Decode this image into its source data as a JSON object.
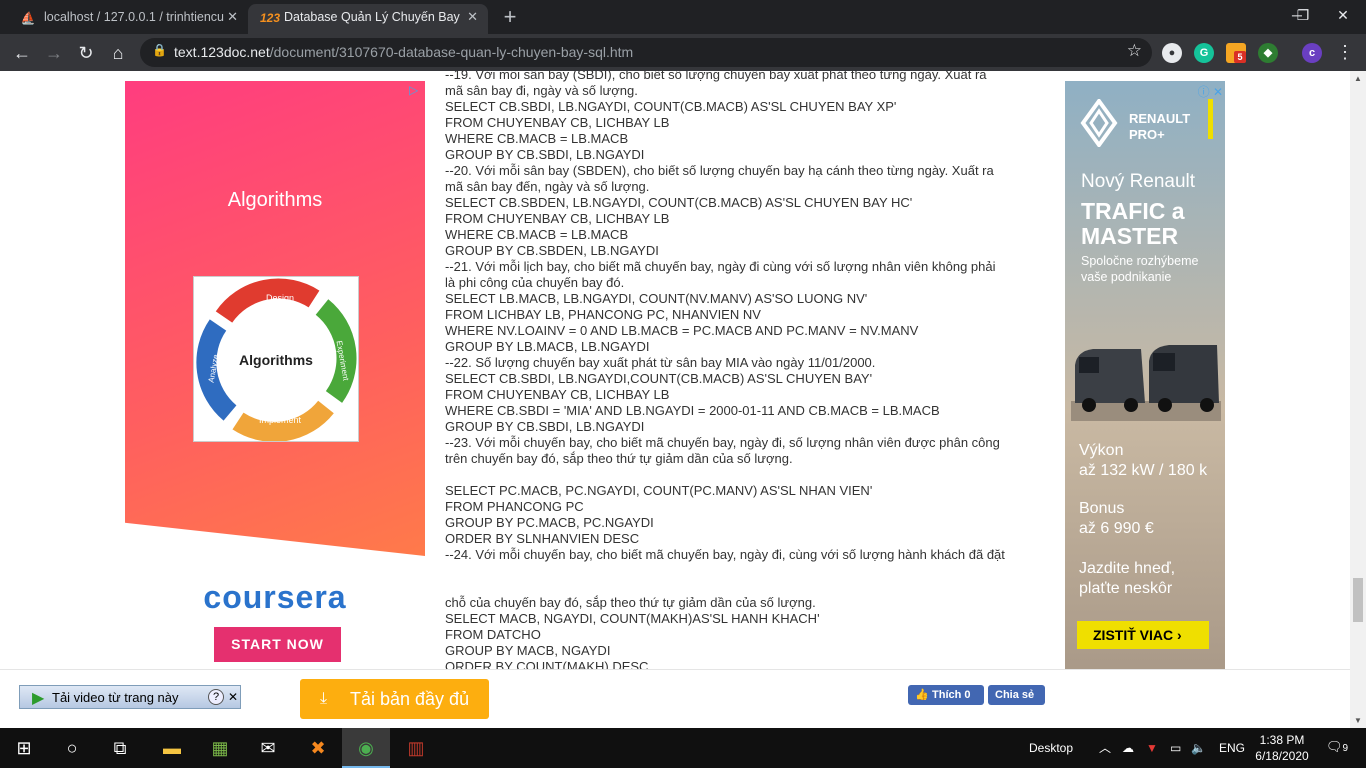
{
  "browser": {
    "tabs": [
      {
        "title": "localhost / 127.0.0.1 / trinhtiencu",
        "favicon": "phpmyadmin-icon",
        "active": false
      },
      {
        "title": "Database Quản Lý Chuyến Bay (S",
        "favicon": "123doc-icon",
        "active": true
      }
    ],
    "new_tab": "+",
    "url_host": "text.123doc.net",
    "url_path": "/document/3107670-database-quan-ly-chuyen-bay-sql.htm",
    "extension_badge": "5",
    "profile_initial": "c"
  },
  "left_ad": {
    "headline": "Algorithms",
    "diagram_center": "Algorithms",
    "diagram_labels": {
      "top": "Design",
      "right": "Experiment",
      "bottom": "Implement",
      "left": "Analyze"
    },
    "brand": "coursera",
    "cta": "START NOW"
  },
  "document": {
    "lines": [
      "--19. Với mỗi sân bay (SBDI), cho biết số lượng chuyến bay xuất phát theo từng ngày. Xuất ra",
      "mã sân bay đi, ngày và số lượng.",
      "SELECT CB.SBDI, LB.NGAYDI, COUNT(CB.MACB) AS'SL CHUYEN BAY XP'",
      "FROM CHUYENBAY CB, LICHBAY LB",
      "WHERE CB.MACB = LB.MACB",
      "GROUP BY CB.SBDI, LB.NGAYDI",
      "--20. Với mỗi sân bay (SBDEN), cho biết số lượng chuyến bay hạ cánh theo từng ngày. Xuất ra",
      "mã sân bay đến, ngày và số lượng.",
      "SELECT CB.SBDEN, LB.NGAYDI, COUNT(CB.MACB) AS'SL CHUYEN BAY HC'",
      "FROM CHUYENBAY CB, LICHBAY LB",
      "WHERE CB.MACB = LB.MACB",
      "GROUP BY CB.SBDEN, LB.NGAYDI",
      "--21. Với mỗi lịch bay, cho biết mã chuyến bay, ngày đi cùng với số lượng nhân viên không phải",
      "là phi công của chuyến bay đó.",
      "SELECT LB.MACB, LB.NGAYDI, COUNT(NV.MANV) AS'SO LUONG NV'",
      "FROM LICHBAY LB, PHANCONG PC, NHANVIEN NV",
      "WHERE NV.LOAINV = 0 AND LB.MACB = PC.MACB AND PC.MANV = NV.MANV",
      "GROUP BY LB.MACB, LB.NGAYDI",
      "--22. Số lượng chuyến bay xuất phát từ sân bay MIA vào ngày 11/01/2000.",
      "SELECT CB.SBDI, LB.NGAYDI,COUNT(CB.MACB) AS'SL CHUYEN BAY'",
      "FROM CHUYENBAY CB, LICHBAY LB",
      "WHERE CB.SBDI = 'MIA' AND LB.NGAYDI = 2000-01-11 AND CB.MACB = LB.MACB",
      "GROUP BY CB.SBDI, LB.NGAYDI",
      "--23. Với mỗi chuyến bay, cho biết mã chuyến bay, ngày đi, số lượng nhân viên được phân công",
      "trên chuyến bay đó, sắp theo thứ tự giảm dần của số lượng.",
      "",
      "SELECT PC.MACB, PC.NGAYDI, COUNT(PC.MANV) AS'SL NHAN VIEN'",
      "FROM PHANCONG PC",
      "GROUP BY PC.MACB, PC.NGAYDI",
      "ORDER BY SLNHANVIEN DESC",
      "--24. Với mỗi chuyến bay, cho biết mã chuyến bay, ngày đi, cùng với số lượng hành khách đã đặt",
      "",
      "",
      "chỗ của chuyến bay đó, sắp theo thứ tự giảm dần của số lượng.",
      "SELECT MACB, NGAYDI, COUNT(MAKH)AS'SL HANH KHACH'",
      "FROM DATCHO",
      "GROUP BY MACB, NGAYDI",
      "ORDER BY COUNT(MAKH) DESC"
    ]
  },
  "right_ad": {
    "brand": "RENAULT PRO+",
    "line1": "Nový Renault",
    "line2": "TRAFIC a MASTER",
    "line3": "Spoločne rozhýbeme vaše podnikanie",
    "power_label": "Výkon",
    "power_value": "až 132 kW / 180 k",
    "bonus_label": "Bonus",
    "bonus_value": "až 6 990 €",
    "slogan": "Jazdite hneď, plaťte neskôr",
    "cta": "ZISTIŤ VIAC ›"
  },
  "bottom_bar": {
    "video_button": "Tải video từ trang này",
    "download_button": "Tải bản đầy đủ",
    "fb_like": "Thích 0",
    "fb_share": "Chia sẻ"
  },
  "taskbar": {
    "desktop_label": "Desktop",
    "language": "ENG",
    "time": "1:38 PM",
    "date": "6/18/2020",
    "notifications": "9"
  }
}
